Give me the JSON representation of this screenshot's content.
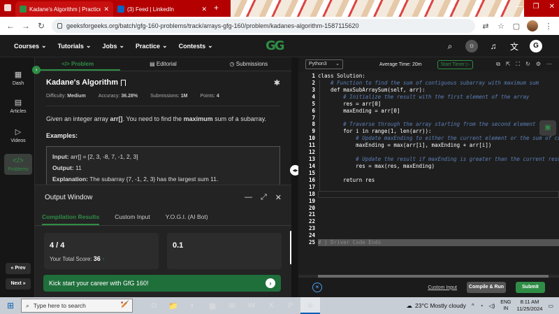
{
  "browser": {
    "tabs": [
      {
        "label": "Kadane's Algorithm | Practice |",
        "active": true
      },
      {
        "label": "(3) Feed | LinkedIn",
        "active": false
      }
    ],
    "new_tab": "+",
    "url": "geeksforgeeks.org/batch/gfg-160-problems/track/arrays-gfg-160/problem/kadanes-algorithm-1587115620"
  },
  "site_nav": {
    "items": [
      "Courses",
      "Tutorials",
      "Jobs",
      "Practice",
      "Contests"
    ],
    "logo": "GG",
    "avatar": "G"
  },
  "sidebar": {
    "items": [
      {
        "label": "Dash",
        "icon": "dashboard-icon"
      },
      {
        "label": "Articles",
        "icon": "articles-icon"
      },
      {
        "label": "Videos",
        "icon": "video-icon"
      },
      {
        "label": "Problems",
        "icon": "code-icon"
      }
    ],
    "prev": "« Prev",
    "next": "Next »"
  },
  "problem": {
    "tabs": [
      "</> Problem",
      "Editorial",
      "Submissions"
    ],
    "title": "Kadane's Algorithm",
    "difficulty_label": "Difficulty:",
    "difficulty": "Medium",
    "accuracy_label": "Accuracy:",
    "accuracy": "36.28%",
    "submissions_label": "Submissions:",
    "submissions": "1M",
    "points_label": "Points:",
    "points": "4",
    "desc_pre": "Given an integer array ",
    "desc_arr": "arr[]",
    "desc_mid": ". You need to find the ",
    "desc_max": "maximum",
    "desc_post": " sum of a subarray.",
    "examples": "Examples:",
    "input_label": "Input:",
    "input": "arr[] = [2, 3, -8, 7, -1, 2, 3]",
    "output_label": "Output:",
    "output": "11",
    "explanation_label": "Explanation:",
    "explanation": "The subarray {7, -1, 2, 3} has the largest sum 11."
  },
  "output_window": {
    "title": "Output Window",
    "tabs": [
      "Compilation Results",
      "Custom Input",
      "Y.O.G.I. (AI Bot)"
    ],
    "test_cases": "4 / 4",
    "score_label": "Your Total Score:",
    "score": "36",
    "time": "0.1",
    "banner": "Kick start your career with GfG 160!"
  },
  "editor": {
    "language": "Python3",
    "avg_time": "Average Time: 20m",
    "timer": "Start Timer",
    "code_lines": [
      "class Solution:",
      "    # Function to find the sum of contiguous subarray with maximum sum",
      "    def maxSubArraySum(self, arr):",
      "        # Initialize the result with the first element of the array",
      "        res = arr[0]",
      "        maxEnding = arr[0]",
      "",
      "        # Traverse through the array starting from the second element",
      "        for i in range(1, len(arr)):",
      "            # Update maxEnding to either the current element or the sum of cu",
      "            maxEnding = max(arr[i], maxEnding + arr[i])",
      "",
      "            # Update the result if maxEnding is greater than the current resu",
      "            res = max(res, maxEnding)",
      "",
      "        return res",
      "",
      "",
      "",
      "",
      "",
      "",
      "",
      "",
      "# } Driver Code Ends"
    ],
    "custom_input": "Custom Input",
    "compile_run": "Compile & Run",
    "submit": "Submit"
  },
  "taskbar": {
    "search_placeholder": "Type here to search",
    "weather": "23°C  Mostly cloudy",
    "lang_top": "ENG",
    "lang_bottom": "IN",
    "time": "8:11 AM",
    "date": "11/25/2024"
  },
  "colors": {
    "brand": "#2f8d46",
    "browser_tabstrip": "#b40000",
    "taskbar": "#c8ced6"
  }
}
